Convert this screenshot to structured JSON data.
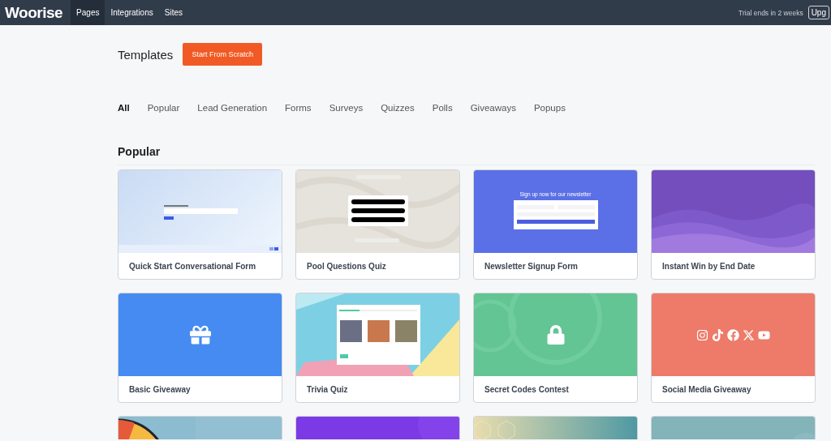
{
  "navbar": {
    "logo": "Woorise",
    "links": [
      {
        "label": "Pages",
        "selected": true
      },
      {
        "label": "Integrations",
        "selected": false
      },
      {
        "label": "Sites",
        "selected": false
      }
    ],
    "trial_notice": "Trial ends in 2 weeks",
    "upgrade_button": "Upg"
  },
  "header": {
    "title": "Templates",
    "button": "Start From Scratch"
  },
  "tabs": [
    {
      "label": "All",
      "selected": true
    },
    {
      "label": "Popular",
      "selected": false
    },
    {
      "label": "Lead Generation",
      "selected": false
    },
    {
      "label": "Forms",
      "selected": false
    },
    {
      "label": "Surveys",
      "selected": false
    },
    {
      "label": "Quizzes",
      "selected": false
    },
    {
      "label": "Polls",
      "selected": false
    },
    {
      "label": "Giveaways",
      "selected": false
    },
    {
      "label": "Popups",
      "selected": false
    }
  ],
  "section_title": "Popular",
  "templates": [
    {
      "kind": "form",
      "title": "Quick Start Conversational Form"
    },
    {
      "kind": "quiz",
      "title": "Pool Questions Quiz"
    },
    {
      "kind": "newsletter",
      "title": "Newsletter Signup Form",
      "preview_heading": "Sign up now for our newsletter"
    },
    {
      "kind": "waves",
      "title": "Instant Win by End Date"
    },
    {
      "kind": "gift",
      "title": "Basic Giveaway"
    },
    {
      "kind": "trivia",
      "title": "Trivia Quiz"
    },
    {
      "kind": "lock",
      "title": "Secret Codes Contest"
    },
    {
      "kind": "social",
      "title": "Social Media Giveaway"
    },
    {
      "kind": "wheel"
    },
    {
      "kind": "purple"
    },
    {
      "kind": "hex"
    },
    {
      "kind": "teal"
    }
  ]
}
